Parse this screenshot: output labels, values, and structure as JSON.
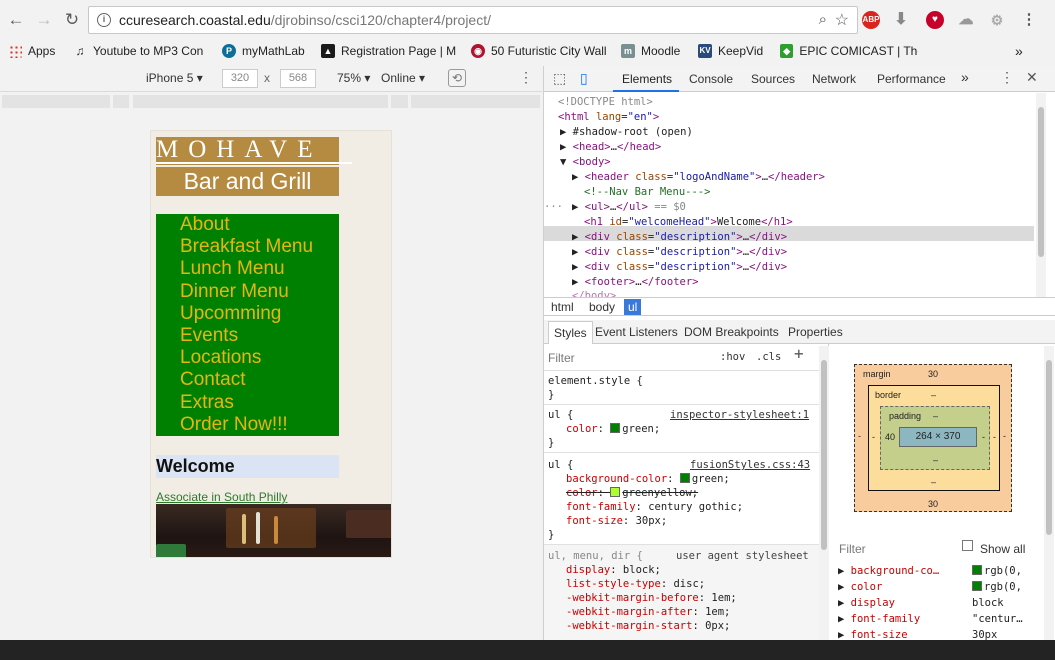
{
  "browser": {
    "url_host": "ccuresearch.coastal.edu",
    "url_path": "/djrobinso/csci120/chapter4/project/",
    "extensions": [
      "ABP",
      "iHeart",
      "download",
      "cloud",
      "settings"
    ]
  },
  "bookmarks": [
    {
      "label": "Apps",
      "icon": "apps-grid-icon"
    },
    {
      "label": "Youtube to MP3 Con",
      "icon": "music-icon"
    },
    {
      "label": "myMathLab",
      "icon": "pearson-icon"
    },
    {
      "label": "Registration Page | M",
      "icon": "registration-icon"
    },
    {
      "label": "50 Futuristic City Wall",
      "icon": "wallpaper-icon"
    },
    {
      "label": "Moodle",
      "icon": "moodle-icon"
    },
    {
      "label": "KeepVid",
      "icon": "keepvid-icon"
    },
    {
      "label": "EPIC COMICAST | The",
      "icon": "comicast-icon"
    }
  ],
  "device_toolbar": {
    "device": "iPhone 5",
    "width": "320",
    "height": "568",
    "times": "x",
    "zoom": "75%",
    "network": "Online"
  },
  "page": {
    "logo_top": "MOHAVE",
    "logo_bottom": "Bar and Grill",
    "nav": [
      "About",
      "Breakfast Menu",
      "Lunch Menu",
      "Dinner Menu",
      "Upcomming",
      "Events",
      "Locations",
      "Contact",
      "Extras",
      "Order Now!!!"
    ],
    "welcome": "Welcome",
    "link": "Associate in South Philly"
  },
  "devtools": {
    "tabs": [
      "Elements",
      "Console",
      "Sources",
      "Network",
      "Performance"
    ],
    "more": "»",
    "dom": {
      "doctype": "<!DOCTYPE html>",
      "html_open": "html",
      "html_attr": "lang",
      "html_attr_val": "\"en\"",
      "shadow": "#shadow-root (open)",
      "head": "head",
      "body": "body",
      "header_tag": "header",
      "header_class": "class",
      "header_class_val": "\"logoAndName\"",
      "comment": "<!--Nav Bar Menu--->",
      "ul": "ul",
      "sel_marker": "== $0",
      "h1_tag": "h1",
      "h1_attr": "id",
      "h1_val": "\"welcomeHead\"",
      "h1_text": "Welcome",
      "div_tag": "div",
      "div_attr": "class",
      "div_val": "\"description\"",
      "footer": "footer",
      "ellipsis": "…",
      "body_close": "</body>"
    },
    "breadcrumbs": [
      "html",
      "body",
      "ul"
    ],
    "sub_tabs": [
      "Styles",
      "Event Listeners",
      "DOM Breakpoints",
      "Properties"
    ],
    "filter_placeholder": "Filter",
    "hov": ":hov",
    "cls": ".cls",
    "rules": [
      {
        "selector": "element.style {",
        "close": "}"
      },
      {
        "selector": "ul {",
        "source": "inspector-stylesheet:1",
        "props": [
          {
            "name": "color",
            "value": "green;",
            "swatch": "#008000"
          }
        ],
        "close": "}"
      },
      {
        "selector": "ul {",
        "source": "fusionStyles.css:43",
        "props": [
          {
            "name": "background-color",
            "value": "green;",
            "swatch": "#008000"
          },
          {
            "name": "color",
            "value": "greenyellow;",
            "swatch": "#adff2f",
            "struck": true
          },
          {
            "name": "font-family",
            "value": "century gothic;"
          },
          {
            "name": "font-size",
            "value": "30px;"
          }
        ],
        "close": "}"
      },
      {
        "selector": "ul, menu, dir {",
        "source": "user agent stylesheet",
        "props": [
          {
            "name": "display",
            "value": "block;"
          },
          {
            "name": "list-style-type",
            "value": "disc;"
          },
          {
            "name": "-webkit-margin-before",
            "value": "1em;"
          },
          {
            "name": "-webkit-margin-after",
            "value": "1em;"
          },
          {
            "name": "-webkit-margin-start",
            "value": "0px;"
          }
        ]
      }
    ],
    "box_model": {
      "margin_label": "margin",
      "margin_top": "30",
      "margin_bottom": "30",
      "margin_right": "-",
      "margin_left": "-",
      "border_label": "border",
      "border_top": "–",
      "border_bottom": "–",
      "border_left": "-",
      "border_right": "-",
      "padding_label": "padding",
      "padding_top": "–",
      "padding_bottom": "–",
      "padding_left": "40",
      "padding_right": "-",
      "content": "264 × 370"
    },
    "computed_filter": "Filter",
    "show_all": "Show all",
    "computed": [
      {
        "name": "background-co…",
        "value": "rgb(0,",
        "swatch": "#008000"
      },
      {
        "name": "color",
        "value": "rgb(0,",
        "swatch": "#008000"
      },
      {
        "name": "display",
        "value": "block"
      },
      {
        "name": "font-family",
        "value": "\"centur…"
      },
      {
        "name": "font-size",
        "value": "30px"
      }
    ]
  }
}
